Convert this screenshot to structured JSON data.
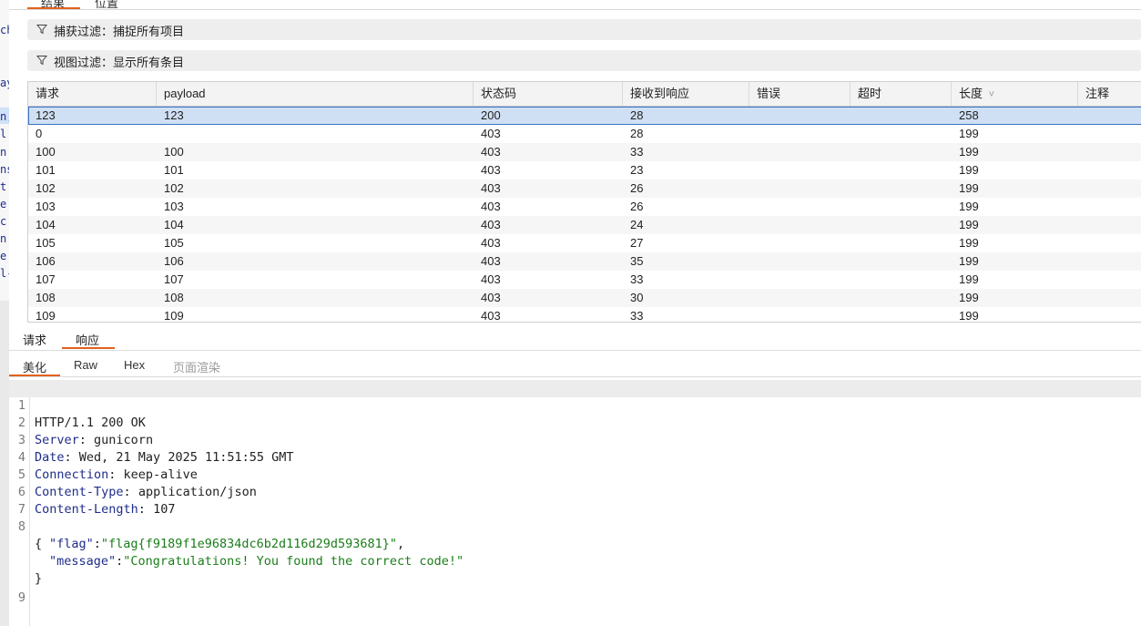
{
  "top_tabs": [
    "结果",
    "位置"
  ],
  "filters": {
    "capture": "捕获过滤：捕捉所有项目",
    "view": "视图过滤：显示所有条目"
  },
  "left_fragments": [
    "ch",
    "ay",
    "n,",
    "l",
    "n",
    "ns",
    "t",
    "e",
    "c",
    "n",
    "e",
    "l-"
  ],
  "table": {
    "columns": [
      "请求",
      "payload",
      "状态码",
      "接收到响应",
      "错误",
      "超时",
      "长度",
      "注释"
    ],
    "sort_indicator": "˅",
    "rows": [
      [
        "123",
        "123",
        "200",
        "28",
        "",
        "",
        "258",
        ""
      ],
      [
        "0",
        "",
        "403",
        "28",
        "",
        "",
        "199",
        ""
      ],
      [
        "100",
        "100",
        "403",
        "33",
        "",
        "",
        "199",
        ""
      ],
      [
        "101",
        "101",
        "403",
        "23",
        "",
        "",
        "199",
        ""
      ],
      [
        "102",
        "102",
        "403",
        "26",
        "",
        "",
        "199",
        ""
      ],
      [
        "103",
        "103",
        "403",
        "26",
        "",
        "",
        "199",
        ""
      ],
      [
        "104",
        "104",
        "403",
        "24",
        "",
        "",
        "199",
        ""
      ],
      [
        "105",
        "105",
        "403",
        "27",
        "",
        "",
        "199",
        ""
      ],
      [
        "106",
        "106",
        "403",
        "35",
        "",
        "",
        "199",
        ""
      ],
      [
        "107",
        "107",
        "403",
        "33",
        "",
        "",
        "199",
        ""
      ],
      [
        "108",
        "108",
        "403",
        "30",
        "",
        "",
        "199",
        ""
      ],
      [
        "109",
        "109",
        "403",
        "33",
        "",
        "",
        "199",
        ""
      ]
    ]
  },
  "rr_tabs": {
    "request": "请求",
    "response": "响应"
  },
  "view_tabs": {
    "pretty": "美化",
    "raw": "Raw",
    "hex": "Hex",
    "render": "页面渲染"
  },
  "response": {
    "status_line": "HTTP/1.1 200 OK",
    "headers": [
      {
        "name": "Server",
        "value": "gunicorn"
      },
      {
        "name": "Date",
        "value": "Wed, 21 May 2025 11:51:55 GMT"
      },
      {
        "name": "Connection",
        "value": "keep-alive"
      },
      {
        "name": "Content-Type",
        "value": "application/json"
      },
      {
        "name": "Content-Length",
        "value": "107"
      }
    ],
    "body": {
      "open": "{",
      "k1": "\"flag\"",
      "v1": "\"flag{f9189f1e96834dc6b2d116d29d593681}\"",
      "k2": "\"message\"",
      "v2": "\"Congratulations! You found the correct code!\"",
      "close": "}"
    },
    "line_numbers": [
      "1",
      "2",
      "3",
      "4",
      "5",
      "6",
      "7",
      "8",
      "9"
    ]
  },
  "colors": {
    "accent": "#e2621c",
    "selected_row": "#cfe0f5",
    "header_key": "#1f2d8a",
    "json_value": "#1b7d1b"
  }
}
